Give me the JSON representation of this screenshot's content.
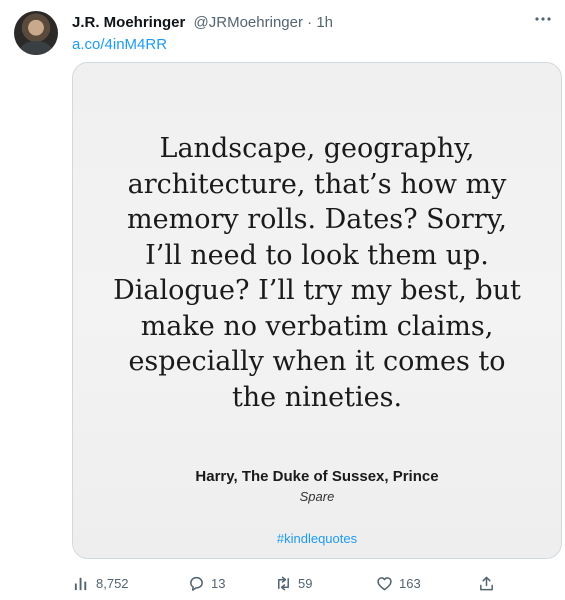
{
  "tweet": {
    "display_name": "J.R. Moehringer",
    "handle": "@JRMoehringer",
    "separator": "·",
    "time": "1h",
    "more_icon": "ellipsis-icon",
    "link_text": "a.co/4inM4RR"
  },
  "card": {
    "quote_lines": [
      "Landscape, geography,",
      "architecture, that’s how my",
      "memory rolls. Dates? Sorry,",
      "I’ll need to look them up.",
      "Dialogue? I’ll try my best, but",
      "make no verbatim claims,",
      "especially when it comes to",
      "the nineties."
    ],
    "author": "Harry, The Duke of Sussex, Prince",
    "book": "Spare",
    "hashtag_prefix": "#kindle",
    "hashtag_suffix": "quotes"
  },
  "actions": {
    "views": "8,752",
    "replies": "13",
    "retweets": "59",
    "likes": "163"
  },
  "colors": {
    "link": "#1d9bf0",
    "muted": "#536471",
    "card_border": "#cfd9de",
    "card_background": "#eeeeee"
  }
}
